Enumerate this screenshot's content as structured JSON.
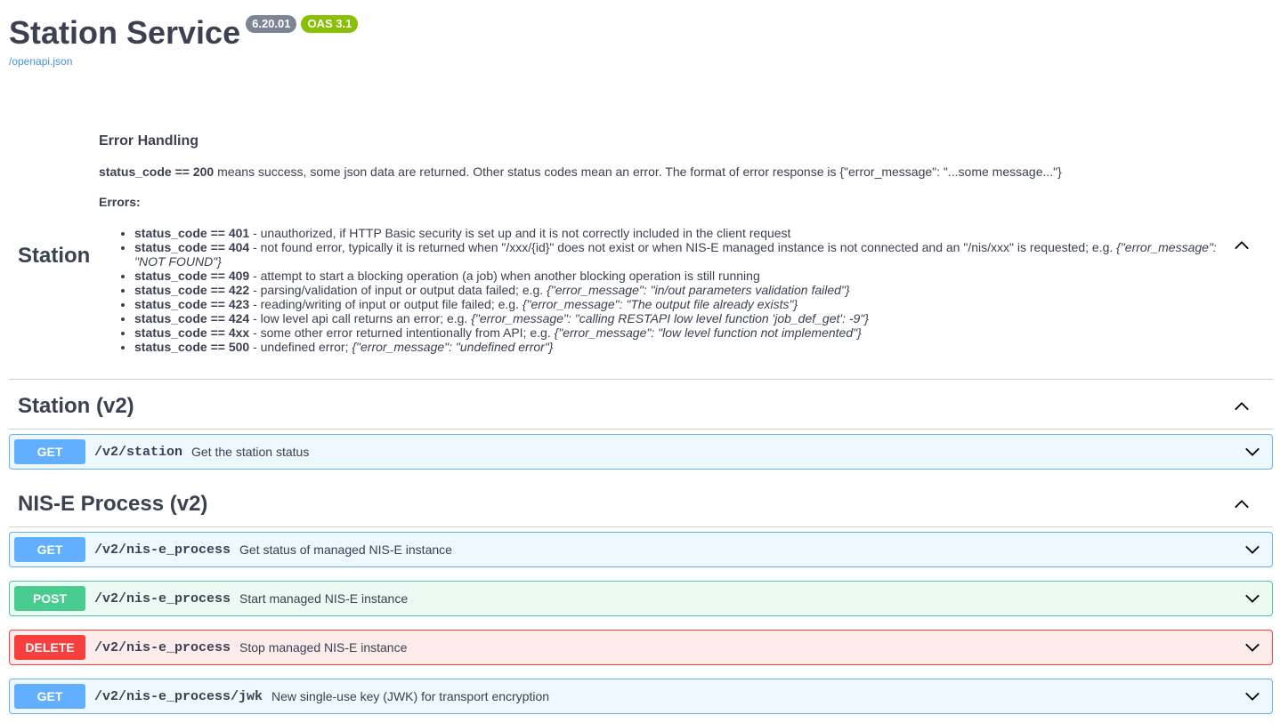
{
  "info": {
    "title": "Station Service",
    "version": "6.20.01",
    "oas": "OAS 3.1",
    "spec_link": "/openapi.json"
  },
  "tags": [
    {
      "name": "Station",
      "description": {
        "heading": "Error Handling",
        "intro_bold": "status_code == 200",
        "intro_text": " means success, some json data are returned. Other status codes mean an error. The format of error response is {\"error_message\": \"...some message...\"}",
        "errors_label": "Errors:",
        "errors": [
          {
            "code": "status_code == 401",
            "text": " - unauthorized, if HTTP Basic security is set up and it is not correctly included in the client request",
            "example": ""
          },
          {
            "code": "status_code == 404",
            "text": " - not found error, typically it is returned when \"/xxx/{id}\" does not exist or when NIS-E managed instance is not connected and an \"/nis/xxx\" is requested; e.g. ",
            "example": "{\"error_message\": \"NOT FOUND\"}"
          },
          {
            "code": "status_code == 409",
            "text": " - attempt to start a blocking operation (a job) when another blocking operation is still running",
            "example": ""
          },
          {
            "code": "status_code == 422",
            "text": " - parsing/validation of input or output data failed; e.g. ",
            "example": "{\"error_message\": \"in/out parameters validation failed\"}"
          },
          {
            "code": "status_code == 423",
            "text": " - reading/writing of input or output file failed; e.g. ",
            "example": "{\"error_message\": \"The output file already exists\"}"
          },
          {
            "code": "status_code == 424",
            "text": " - low level api call returns an error; e.g. ",
            "example": "{\"error_message\": \"calling RESTAPI low level function 'job_def_get': -9\"}"
          },
          {
            "code": "status_code == 4xx",
            "text": " - some other error returned intentionally from API; e.g. ",
            "example": "{\"error_message\": \"low level function not implemented\"}"
          },
          {
            "code": "status_code == 500",
            "text": " - undefined error; ",
            "example": "{\"error_message\": \"undefined error\"}"
          }
        ]
      }
    },
    {
      "name": "Station (v2)"
    },
    {
      "name": "NIS-E Process (v2)"
    }
  ],
  "operations": [
    {
      "method": "GET",
      "path": "/v2/station",
      "summary": "Get the station status"
    },
    {
      "method": "GET",
      "path": "/v2/nis-e_process",
      "summary": "Get status of managed NIS-E instance"
    },
    {
      "method": "POST",
      "path": "/v2/nis-e_process",
      "summary": "Start managed NIS-E instance"
    },
    {
      "method": "DELETE",
      "path": "/v2/nis-e_process",
      "summary": "Stop managed NIS-E instance"
    },
    {
      "method": "GET",
      "path": "/v2/nis-e_process/jwk",
      "summary": "New single-use key (JWK) for transport encryption"
    }
  ],
  "icons": {
    "collapse": "chevron-up-icon",
    "expand": "chevron-down-icon"
  },
  "colors": {
    "get": "#61affe",
    "post": "#49cc90",
    "delete": "#f93e3e",
    "version_badge": "#7d8492",
    "oas_badge": "#89bf04",
    "link": "#4990e2"
  }
}
